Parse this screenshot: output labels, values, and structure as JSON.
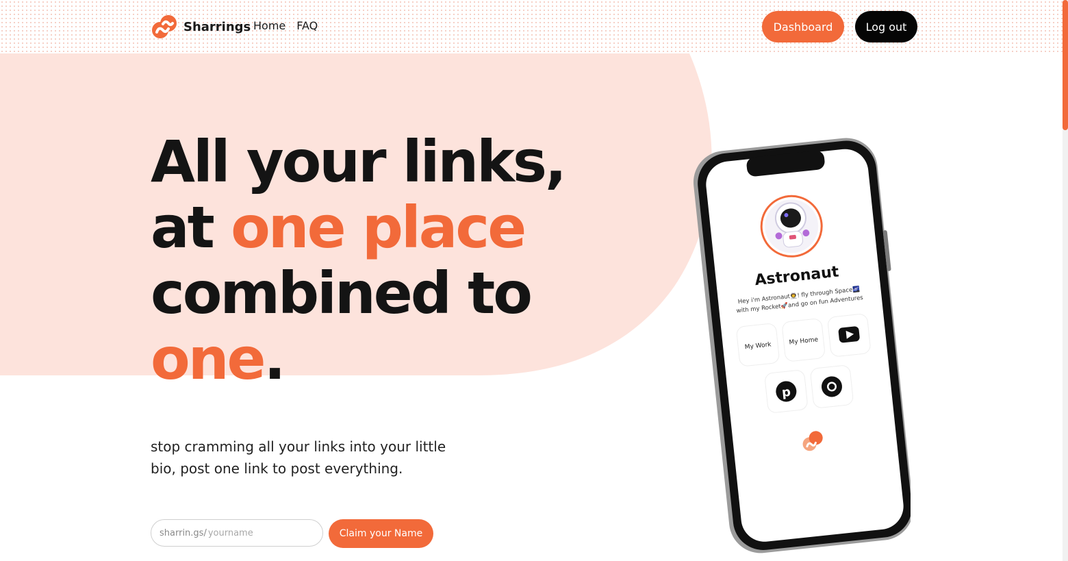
{
  "brand": {
    "name": "Sharrings"
  },
  "nav": {
    "home": "Home",
    "faq": "FAQ"
  },
  "header_buttons": {
    "dashboard": "Dashboard",
    "logout": "Log out"
  },
  "hero": {
    "line1": "All your links,",
    "line2_a": "at ",
    "line2_b": "one place",
    "line3": "combined to",
    "line4_a": "one",
    "line4_b": ".",
    "subtext": "stop cramming all your links into your little bio, post one link to post everything."
  },
  "claim": {
    "prefix": "sharrin.gs/",
    "placeholder": "yourname",
    "button": "Claim your Name"
  },
  "phone_profile": {
    "name": "Astronaut",
    "bio_line1": "Hey i'm Astronaut👨‍🚀! fly through Space🌌",
    "bio_line2": "with my Rocket🚀and go on fun Adventures",
    "link1": "My Work",
    "link2": "My Home",
    "icon_youtube": "youtube-icon",
    "icon_pinterest": "pinterest-icon",
    "icon_chrome": "chrome-icon"
  },
  "colors": {
    "accent": "#f26a3a",
    "blob": "#fde3dc",
    "dark": "#141414"
  }
}
